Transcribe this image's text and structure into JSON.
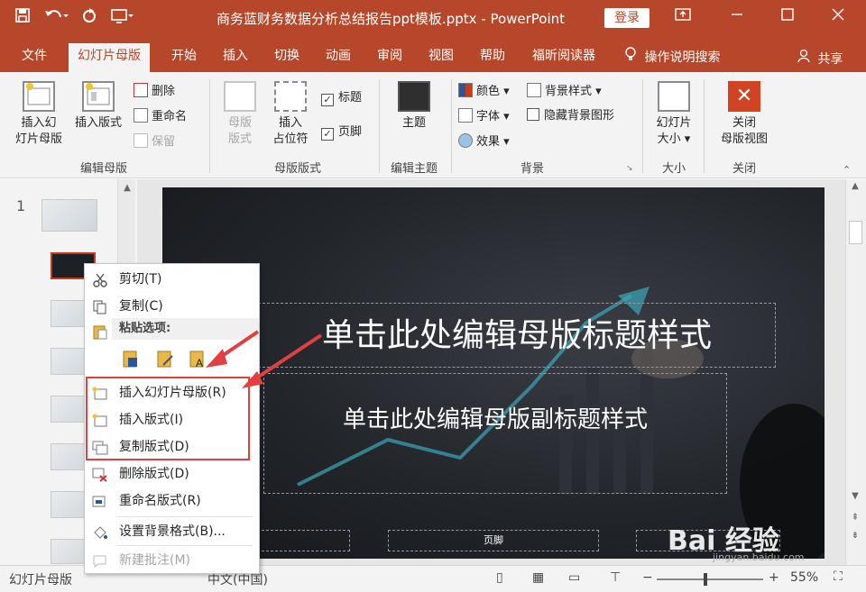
{
  "titlebar": {
    "doc_title": "商务蓝财务数据分析总结报告ppt模板.pptx  -  PowerPoint",
    "login": "登录"
  },
  "tabs": [
    "文件",
    "幻灯片母版",
    "开始",
    "插入",
    "切换",
    "动画",
    "审阅",
    "视图",
    "帮助",
    "福昕阅读器"
  ],
  "tell_me": "操作说明搜索",
  "share": "共享",
  "ribbon": {
    "edit_master": {
      "insert_slide_master": [
        "插入幻",
        "灯片母版"
      ],
      "insert_layout": "插入版式",
      "delete": "删除",
      "rename": "重命名",
      "preserve": "保留",
      "label": "编辑母版"
    },
    "master_layout": {
      "master_layout_btn": [
        "母版",
        "版式"
      ],
      "insert_placeholder": [
        "插入",
        "占位符"
      ],
      "title_chk": "标题",
      "footer_chk": "页脚",
      "label": "母版版式"
    },
    "edit_theme": {
      "theme": "主题",
      "label": "编辑主题"
    },
    "background": {
      "colors": "颜色",
      "fonts": "字体",
      "effects": "效果",
      "bg_styles": "背景样式",
      "hide_bg": "隐藏背景图形",
      "label": "背景"
    },
    "size": {
      "slide_size": [
        "幻灯片",
        "大小"
      ],
      "label": "大小"
    },
    "close": {
      "close_master": [
        "关闭",
        "母版视图"
      ],
      "label": "关闭"
    }
  },
  "thumbs": {
    "first_number": "1"
  },
  "slide": {
    "title": "单击此处编辑母版标题样式",
    "subtitle": "单击此处编辑母版副标题样式",
    "footer": "页脚"
  },
  "context_menu": {
    "cut": "剪切(T)",
    "copy": "复制(C)",
    "paste_options": "粘贴选项:",
    "insert_master": "插入幻灯片母版(R)",
    "insert_layout": "插入版式(I)",
    "duplicate_layout": "复制版式(D)",
    "delete_layout": "删除版式(D)",
    "rename_layout": "重命名版式(R)",
    "format_bg": "设置背景格式(B)...",
    "new_comment": "新建批注(M)"
  },
  "status": {
    "view": "幻灯片母版",
    "lang": "中文(中国)",
    "zoom": "55%"
  },
  "watermark": {
    "logo": "Bai 经验",
    "url": "jingyan.baidu.com"
  },
  "colors": {
    "accent": "#b7472a",
    "highlight": "#e24040"
  }
}
